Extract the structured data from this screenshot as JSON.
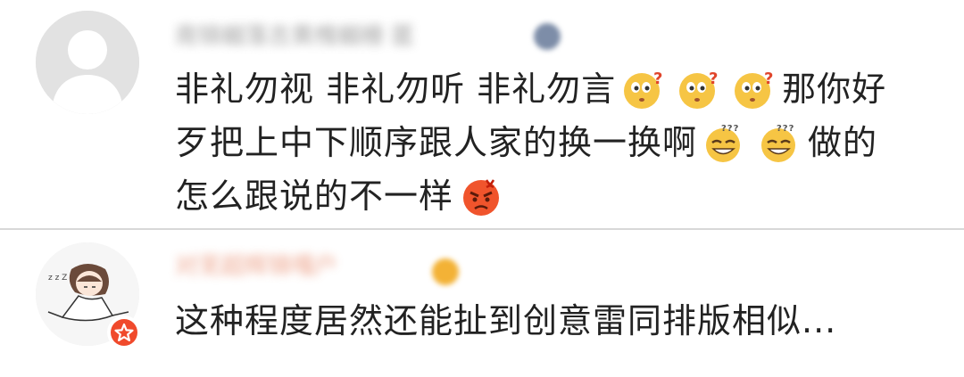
{
  "comments": [
    {
      "username": "南锦樾落吉黄槐樾栅 匿",
      "text_lines": [
        "非礼勿视 非礼勿听 非礼勿言",
        "那你好",
        "歹把上中下顺序跟人家的换一换啊",
        "做的",
        "怎么跟说的不一样"
      ],
      "emoji": [
        "confused-face-icon",
        "confused-face-icon",
        "confused-face-icon",
        "dizzy-smile-face-icon",
        "dizzy-smile-face-icon",
        "angry-face-icon"
      ]
    },
    {
      "username": "对芜超辉锦嘎户",
      "text": "这种程度居然还能扯到创意雷同排版相似...",
      "avatar": "cartoon-girl-avatar",
      "badge": "star-badge-icon"
    }
  ],
  "colors": {
    "divider": "#d8d8d8",
    "badge": "#f04a2c",
    "emoji_yellow": "#f6c544",
    "emoji_angry": "#f0542c"
  }
}
